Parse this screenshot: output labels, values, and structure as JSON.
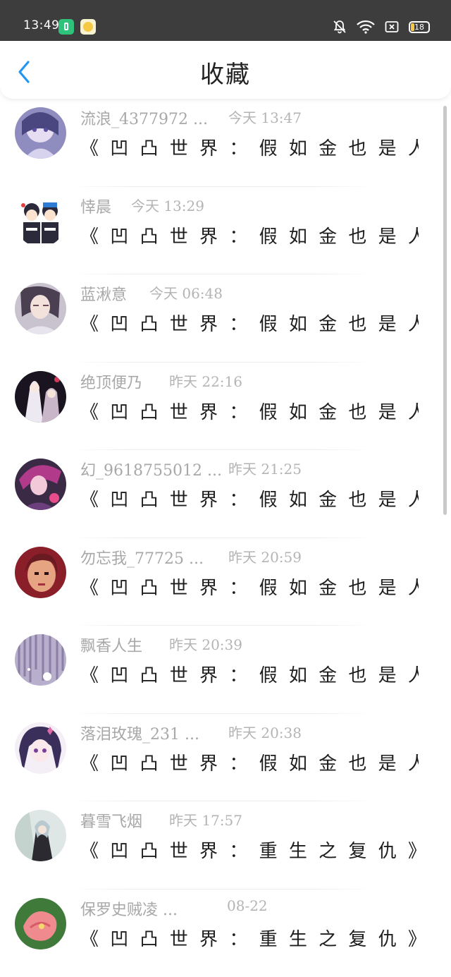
{
  "status_bar": {
    "time": "13:49",
    "battery": "18"
  },
  "header": {
    "title": "收藏"
  },
  "items": [
    {
      "name": "流浪_4377972 ...",
      "time": "今天 13:47",
      "message": "《 凹 凸 世 界 ： 假 如 金 也 是 人 造 人 ..."
    },
    {
      "name": "悻晨",
      "time": "今天 13:29",
      "message": "《 凹 凸 世 界 ： 假 如 金 也 是 人 造 人 ..."
    },
    {
      "name": "蓝湫意",
      "time": "今天 06:48",
      "message": "《 凹 凸 世 界 ： 假 如 金 也 是 人 造 人 ..."
    },
    {
      "name": "绝顶便乃",
      "time": "昨天 22:16",
      "message": "《 凹 凸 世 界 ： 假 如 金 也 是 人 造 人 ..."
    },
    {
      "name": "幻_9618755012 ...",
      "time": "昨天 21:25",
      "message": "《 凹 凸 世 界 ： 假 如 金 也 是 人 造 人 ..."
    },
    {
      "name": "勿忘我_77725 ...",
      "time": "昨天 20:59",
      "message": "《 凹 凸 世 界 ： 假 如 金 也 是 人 造 人 ..."
    },
    {
      "name": "飘香人生",
      "time": "昨天 20:39",
      "message": "《 凹 凸 世 界 ： 假 如 金 也 是 人 造 人 ..."
    },
    {
      "name": "落泪玫瑰_231 ...",
      "time": "昨天 20:38",
      "message": "《 凹 凸 世 界 ： 假 如 金 也 是 人 造 人 ..."
    },
    {
      "name": "暮雪飞烟",
      "time": "昨天 17:57",
      "message": "《 凹 凸 世 界 ： 重 生 之 复 仇 》"
    },
    {
      "name": "保罗史贼凌 ...",
      "time": "08-22",
      "message": "《 凹 凸 世 界 ： 重 生 之 复 仇 》"
    }
  ],
  "colors": {
    "back_arrow": "#2196f3",
    "status_bar_bg": "#3d3d3d"
  },
  "icons": {
    "back": "chevron-left-icon",
    "mute": "bell-off-icon",
    "wifi": "wifi-icon",
    "sim": "sim-card-icon",
    "battery": "battery-icon"
  }
}
